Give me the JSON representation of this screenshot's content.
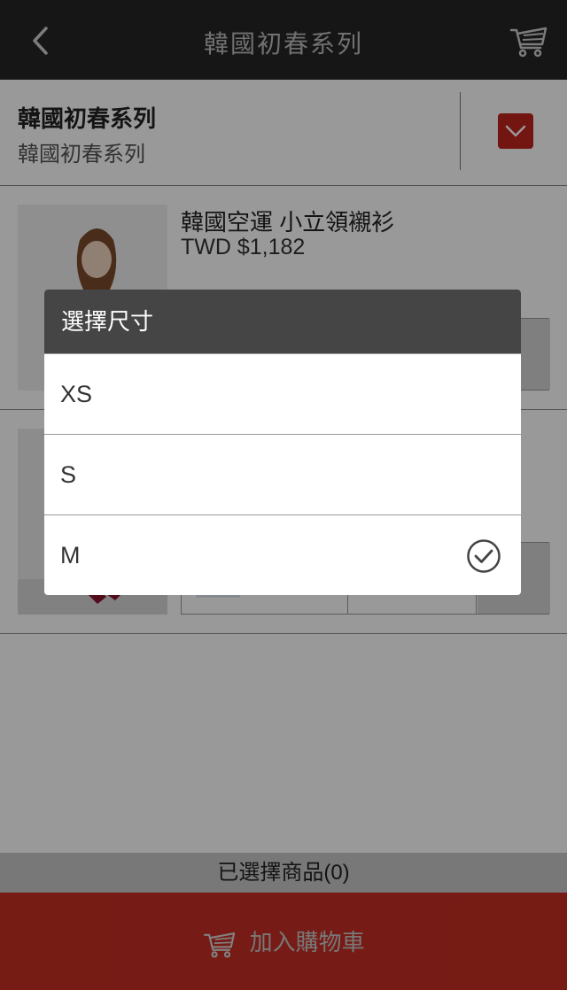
{
  "header": {
    "title": "韓國初春系列",
    "back_icon": "chevron-left-icon",
    "cart_icon": "cart-icon"
  },
  "category": {
    "title": "韓國初春系列",
    "subtitle": "韓國初春系列",
    "dropdown_icon": "chevron-down-icon",
    "accent": "#c0241c"
  },
  "products": [
    {
      "name": "韓國空運 小立領襯衫",
      "price": "TWD $1,182"
    },
    {
      "name": "",
      "price": ""
    }
  ],
  "size_modal": {
    "title": "選擇尺寸",
    "options": [
      {
        "label": "XS",
        "selected": false
      },
      {
        "label": "S",
        "selected": false
      },
      {
        "label": "M",
        "selected": true
      }
    ]
  },
  "selected_bar": {
    "label": "已選擇商品(0)"
  },
  "add_to_cart": {
    "label": "加入購物車",
    "color": "#c52e23"
  }
}
